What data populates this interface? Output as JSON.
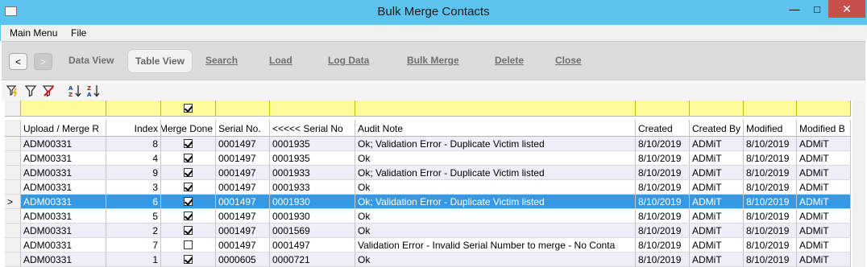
{
  "window": {
    "title": "Bulk Merge Contacts"
  },
  "menu": {
    "items": [
      "Main Menu",
      "File"
    ]
  },
  "toolbar": {
    "back_label": "<",
    "forward_label": ">",
    "data_view": "Data View",
    "table_view": "Table View",
    "search": "Search",
    "load": "Load",
    "log_data": "Log Data",
    "bulk_merge": "Bulk Merge",
    "delete": "Delete",
    "close": "Close"
  },
  "filterbar": {
    "icons": [
      "filter-lightning-icon",
      "filter-icon",
      "clear-filter-icon",
      "sort-ascending-icon",
      "sort-descending-icon"
    ]
  },
  "grid": {
    "headers": [
      "Upload / Merge R",
      "Index",
      "Merge Done",
      "Serial No.",
      "<<<<<  Serial No",
      "Audit Note",
      "Created",
      "Created By",
      "Modified",
      "Modified B"
    ],
    "current_marker": ">",
    "rows": [
      {
        "upload": "ADM00331",
        "index": "8",
        "done": true,
        "serial": "0001497",
        "serial2": "0001935",
        "note": "Ok; Validation Error - Duplicate Victim listed",
        "created": "8/10/2019",
        "created_by": "ADMiT",
        "modified": "8/10/2019",
        "modified_by": "ADMiT"
      },
      {
        "upload": "ADM00331",
        "index": "4",
        "done": true,
        "serial": "0001497",
        "serial2": "0001935",
        "note": "Ok",
        "created": "8/10/2019",
        "created_by": "ADMiT",
        "modified": "8/10/2019",
        "modified_by": "ADMiT"
      },
      {
        "upload": "ADM00331",
        "index": "9",
        "done": true,
        "serial": "0001497",
        "serial2": "0001933",
        "note": "Ok; Validation Error - Duplicate Victim listed",
        "created": "8/10/2019",
        "created_by": "ADMiT",
        "modified": "8/10/2019",
        "modified_by": "ADMiT"
      },
      {
        "upload": "ADM00331",
        "index": "3",
        "done": true,
        "serial": "0001497",
        "serial2": "0001933",
        "note": "Ok",
        "created": "8/10/2019",
        "created_by": "ADMiT",
        "modified": "8/10/2019",
        "modified_by": "ADMiT"
      },
      {
        "upload": "ADM00331",
        "index": "6",
        "done": true,
        "serial": "0001497",
        "serial2": "0001930",
        "note": "Ok; Validation Error - Duplicate Victim listed",
        "created": "8/10/2019",
        "created_by": "ADMiT",
        "modified": "8/10/2019",
        "modified_by": "ADMiT"
      },
      {
        "upload": "ADM00331",
        "index": "5",
        "done": true,
        "serial": "0001497",
        "serial2": "0001930",
        "note": "Ok",
        "created": "8/10/2019",
        "created_by": "ADMiT",
        "modified": "8/10/2019",
        "modified_by": "ADMiT"
      },
      {
        "upload": "ADM00331",
        "index": "2",
        "done": true,
        "serial": "0001497",
        "serial2": "0001569",
        "note": "Ok",
        "created": "8/10/2019",
        "created_by": "ADMiT",
        "modified": "8/10/2019",
        "modified_by": "ADMiT"
      },
      {
        "upload": "ADM00331",
        "index": "7",
        "done": false,
        "serial": "0001497",
        "serial2": "0001497",
        "note": "Validation Error - Invalid Serial Number to merge - No Conta",
        "created": "8/10/2019",
        "created_by": "ADMiT",
        "modified": "8/10/2019",
        "modified_by": "ADMiT"
      },
      {
        "upload": "ADM00331",
        "index": "1",
        "done": true,
        "serial": "0000605",
        "serial2": "0000721",
        "note": "Ok",
        "created": "8/10/2019",
        "created_by": "ADMiT",
        "modified": "8/10/2019",
        "modified_by": "ADMiT"
      }
    ]
  }
}
